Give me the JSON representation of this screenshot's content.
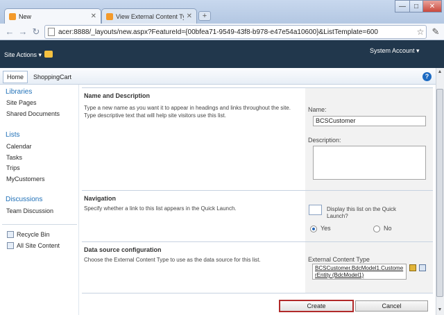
{
  "browser": {
    "tabs": [
      {
        "label": "New",
        "active": true
      },
      {
        "label": "View External Content Ty...",
        "active": false
      }
    ],
    "new_tab_glyph": "+",
    "address": "acer:8888/_layouts/new.aspx?FeatureId={00bfea71-9549-43f8-b978-e47e54a10600}&ListTemplate=600",
    "window_buttons": {
      "minimize": "—",
      "maximize": "□",
      "close": "✕"
    }
  },
  "ribbon": {
    "site_actions": "Site Actions ▾",
    "user": "System Account ▾"
  },
  "topnav": {
    "home": "Home",
    "shopping_cart": "ShoppingCart",
    "help": "?"
  },
  "quick_launch": {
    "libraries_heading": "Libraries",
    "libraries": [
      "Site Pages",
      "Shared Documents"
    ],
    "lists_heading": "Lists",
    "lists": [
      "Calendar",
      "Tasks",
      "Trips",
      "MyCustomers"
    ],
    "discussions_heading": "Discussions",
    "discussions": [
      "Team Discussion"
    ],
    "recycle_bin": "Recycle Bin",
    "all_site_content": "All Site Content"
  },
  "form": {
    "name_section": {
      "title": "Name and Description",
      "description": "Type a new name as you want it to appear in headings and links throughout the site. Type descriptive text that will help site visitors use this list.",
      "name_label": "Name:",
      "name_value": "BCSCustomer",
      "description_label": "Description:",
      "description_value": ""
    },
    "navigation_section": {
      "title": "Navigation",
      "description": "Specify whether a link to this list appears in the Quick Launch.",
      "question": "Display this list on the Quick Launch?",
      "yes": "Yes",
      "no": "No",
      "selected": "Yes"
    },
    "data_source_section": {
      "title": "Data source configuration",
      "description": "Choose the External Content Type to use as the data source for this list.",
      "ect_label": "External Content Type",
      "ect_value": "BCSCustomer.BdcModel1.CustomerEntity (BdcModel1)"
    },
    "create_button": "Create",
    "cancel_button": "Cancel"
  },
  "colors": {
    "ribbon_bg": "#21374c",
    "link_blue": "#1e6fb7",
    "create_highlight": "#b12a2a"
  }
}
